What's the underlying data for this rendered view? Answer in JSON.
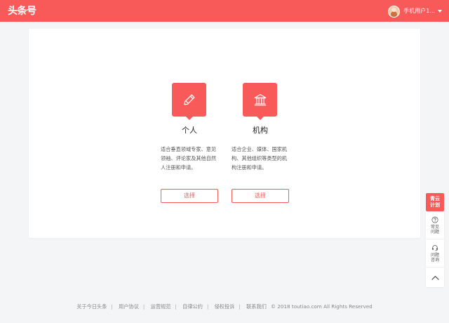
{
  "header": {
    "logo": "头条号",
    "username": "手机用户1...",
    "bg_color": "#f85959"
  },
  "options": [
    {
      "icon": "pencil-icon",
      "title": "个人",
      "description": "适合垂直领域专家、意见\n领袖、评论家及其他自然\n人注册和申请。",
      "button": "选择"
    },
    {
      "icon": "institution-icon",
      "title": "机构",
      "description": "适合企业、媒体、国家机\n构、其他组织等类型的机\n构注册和申请。",
      "button": "选择"
    }
  ],
  "sidebar": {
    "badge": "青云\n计划",
    "items": [
      {
        "icon": "question-icon",
        "label": "常见\n问题"
      },
      {
        "icon": "headset-icon",
        "label": "问题\n咨询"
      }
    ],
    "back_top_icon": "chevron-up-icon"
  },
  "footer": {
    "links": [
      "关于今日头条",
      "用户协议",
      "运营规范",
      "自律公约",
      "侵权投诉",
      "联系我们"
    ],
    "copyright": "© 2018 toutiao.com All Rights Reserved"
  }
}
